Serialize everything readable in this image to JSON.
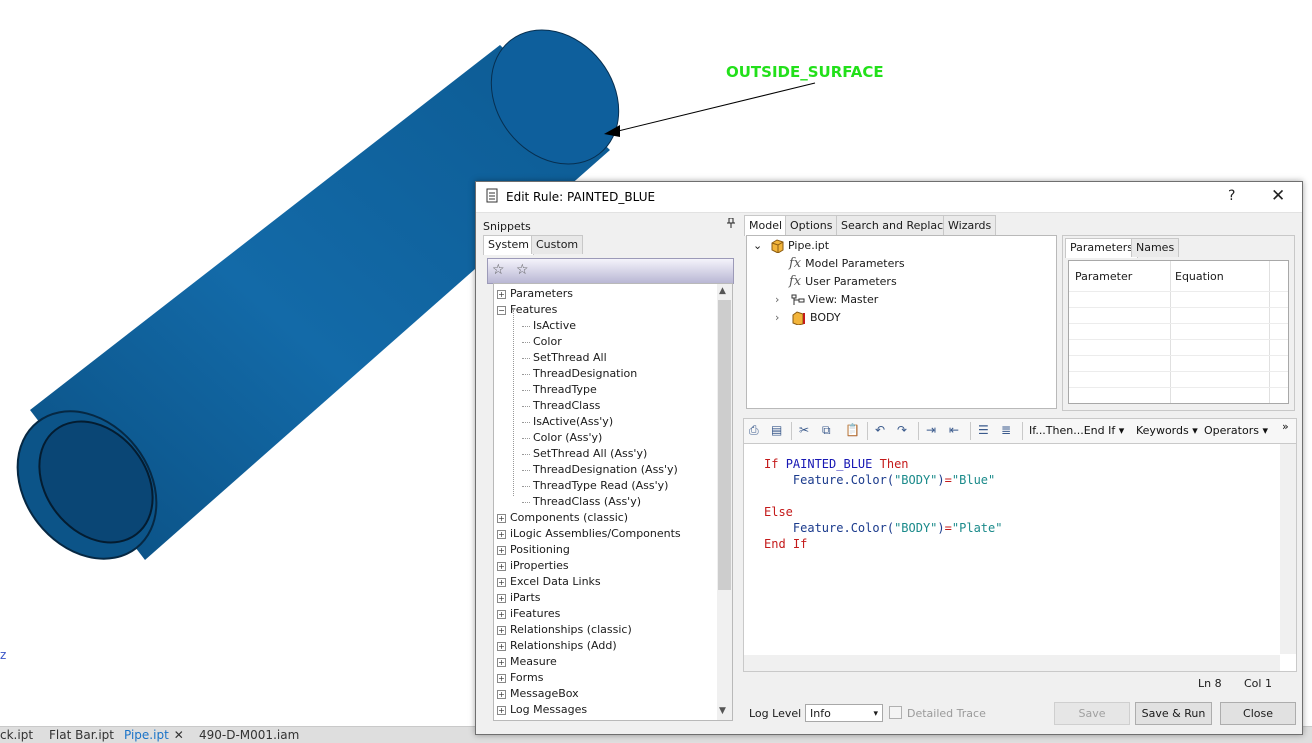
{
  "viewport": {
    "annotation_label": "OUTSIDE_SURFACE",
    "left_edge_glyph": "z"
  },
  "doc_tabs": [
    {
      "label": "ck.ipt",
      "active": false
    },
    {
      "label": "Flat Bar.ipt",
      "active": false
    },
    {
      "label": "Pipe.ipt",
      "active": true
    },
    {
      "label": "490-D-M001.iam",
      "active": false
    }
  ],
  "doc_tab_close": "✕",
  "dialog": {
    "title": "Edit Rule: PAINTED_BLUE",
    "help": "?",
    "close": "✕"
  },
  "snippets": {
    "header": "Snippets",
    "pin": "📌",
    "tabs": [
      "System",
      "Custom"
    ],
    "tree": [
      {
        "label": "Parameters",
        "expander": "+",
        "level": 0
      },
      {
        "label": "Features",
        "expander": "−",
        "level": 0
      },
      {
        "label": "IsActive",
        "level": 1
      },
      {
        "label": "Color",
        "level": 1
      },
      {
        "label": "SetThread All",
        "level": 1
      },
      {
        "label": "ThreadDesignation",
        "level": 1
      },
      {
        "label": "ThreadType",
        "level": 1
      },
      {
        "label": "ThreadClass",
        "level": 1
      },
      {
        "label": "IsActive(Ass'y)",
        "level": 1
      },
      {
        "label": "Color (Ass'y)",
        "level": 1
      },
      {
        "label": "SetThread All (Ass'y)",
        "level": 1
      },
      {
        "label": "ThreadDesignation (Ass'y)",
        "level": 1
      },
      {
        "label": "ThreadType Read (Ass'y)",
        "level": 1
      },
      {
        "label": "ThreadClass (Ass'y)",
        "level": 1
      },
      {
        "label": "Components (classic)",
        "expander": "+",
        "level": 0
      },
      {
        "label": "iLogic Assemblies/Components",
        "expander": "+",
        "level": 0
      },
      {
        "label": "Positioning",
        "expander": "+",
        "level": 0
      },
      {
        "label": "iProperties",
        "expander": "+",
        "level": 0
      },
      {
        "label": "Excel Data Links",
        "expander": "+",
        "level": 0
      },
      {
        "label": "iParts",
        "expander": "+",
        "level": 0
      },
      {
        "label": "iFeatures",
        "expander": "+",
        "level": 0
      },
      {
        "label": "Relationships (classic)",
        "expander": "+",
        "level": 0
      },
      {
        "label": "Relationships (Add)",
        "expander": "+",
        "level": 0
      },
      {
        "label": "Measure",
        "expander": "+",
        "level": 0
      },
      {
        "label": "Forms",
        "expander": "+",
        "level": 0
      },
      {
        "label": "MessageBox",
        "expander": "+",
        "level": 0
      },
      {
        "label": "Log Messages",
        "expander": "+",
        "level": 0
      }
    ]
  },
  "model_tabs": [
    "Model",
    "Options",
    "Search and Replace",
    "Wizards"
  ],
  "model_tree": {
    "root": "Pipe.ipt",
    "model_parameters": "Model Parameters",
    "user_parameters": "User Parameters",
    "view": "View: Master",
    "body": "BODY",
    "fx_glyph": "fx",
    "collapse_glyph": "⌄",
    "expand_glyph": "›"
  },
  "params_panel": {
    "tabs": [
      "Parameters",
      "Names"
    ],
    "columns": [
      "Parameter",
      "Equation"
    ]
  },
  "editor_toolbar": {
    "if_menu": "If...Then...End If",
    "keywords_menu": "Keywords",
    "operators_menu": "Operators",
    "overflow": "»"
  },
  "code": [
    [
      {
        "t": "If ",
        "c": "kw"
      },
      {
        "t": "PAINTED_BLUE",
        "c": "pm2"
      },
      {
        "t": " Then",
        "c": "kw"
      }
    ],
    [
      {
        "t": "    Feature",
        "c": "plain"
      },
      {
        "t": ".Color(",
        "c": "plain"
      },
      {
        "t": "\"BODY\"",
        "c": "str"
      },
      {
        "t": ")",
        "c": "plain"
      },
      {
        "t": "=",
        "c": "eq"
      },
      {
        "t": "\"Blue\"",
        "c": "str"
      }
    ],
    [],
    [
      {
        "t": "Else",
        "c": "kw"
      }
    ],
    [
      {
        "t": "    Feature",
        "c": "plain"
      },
      {
        "t": ".Color(",
        "c": "plain"
      },
      {
        "t": "\"BODY\"",
        "c": "str"
      },
      {
        "t": ")",
        "c": "plain"
      },
      {
        "t": "=",
        "c": "eq"
      },
      {
        "t": "\"Plate\"",
        "c": "str"
      }
    ],
    [
      {
        "t": "End If",
        "c": "kw"
      }
    ]
  ],
  "status": {
    "line": "Ln 8",
    "col": "Col 1"
  },
  "bottom": {
    "log_level_label": "Log Level",
    "log_level_value": "Info",
    "detailed_trace_label": "Detailed Trace",
    "save": "Save",
    "save_run": "Save & Run",
    "close": "Close"
  },
  "colors": {
    "pipe_blue": "#0f5c96",
    "annotation_green": "#22e01a",
    "keyword_red": "#c41a1a",
    "param_blue": "#1818b4",
    "string_teal": "#1a8a8a"
  }
}
